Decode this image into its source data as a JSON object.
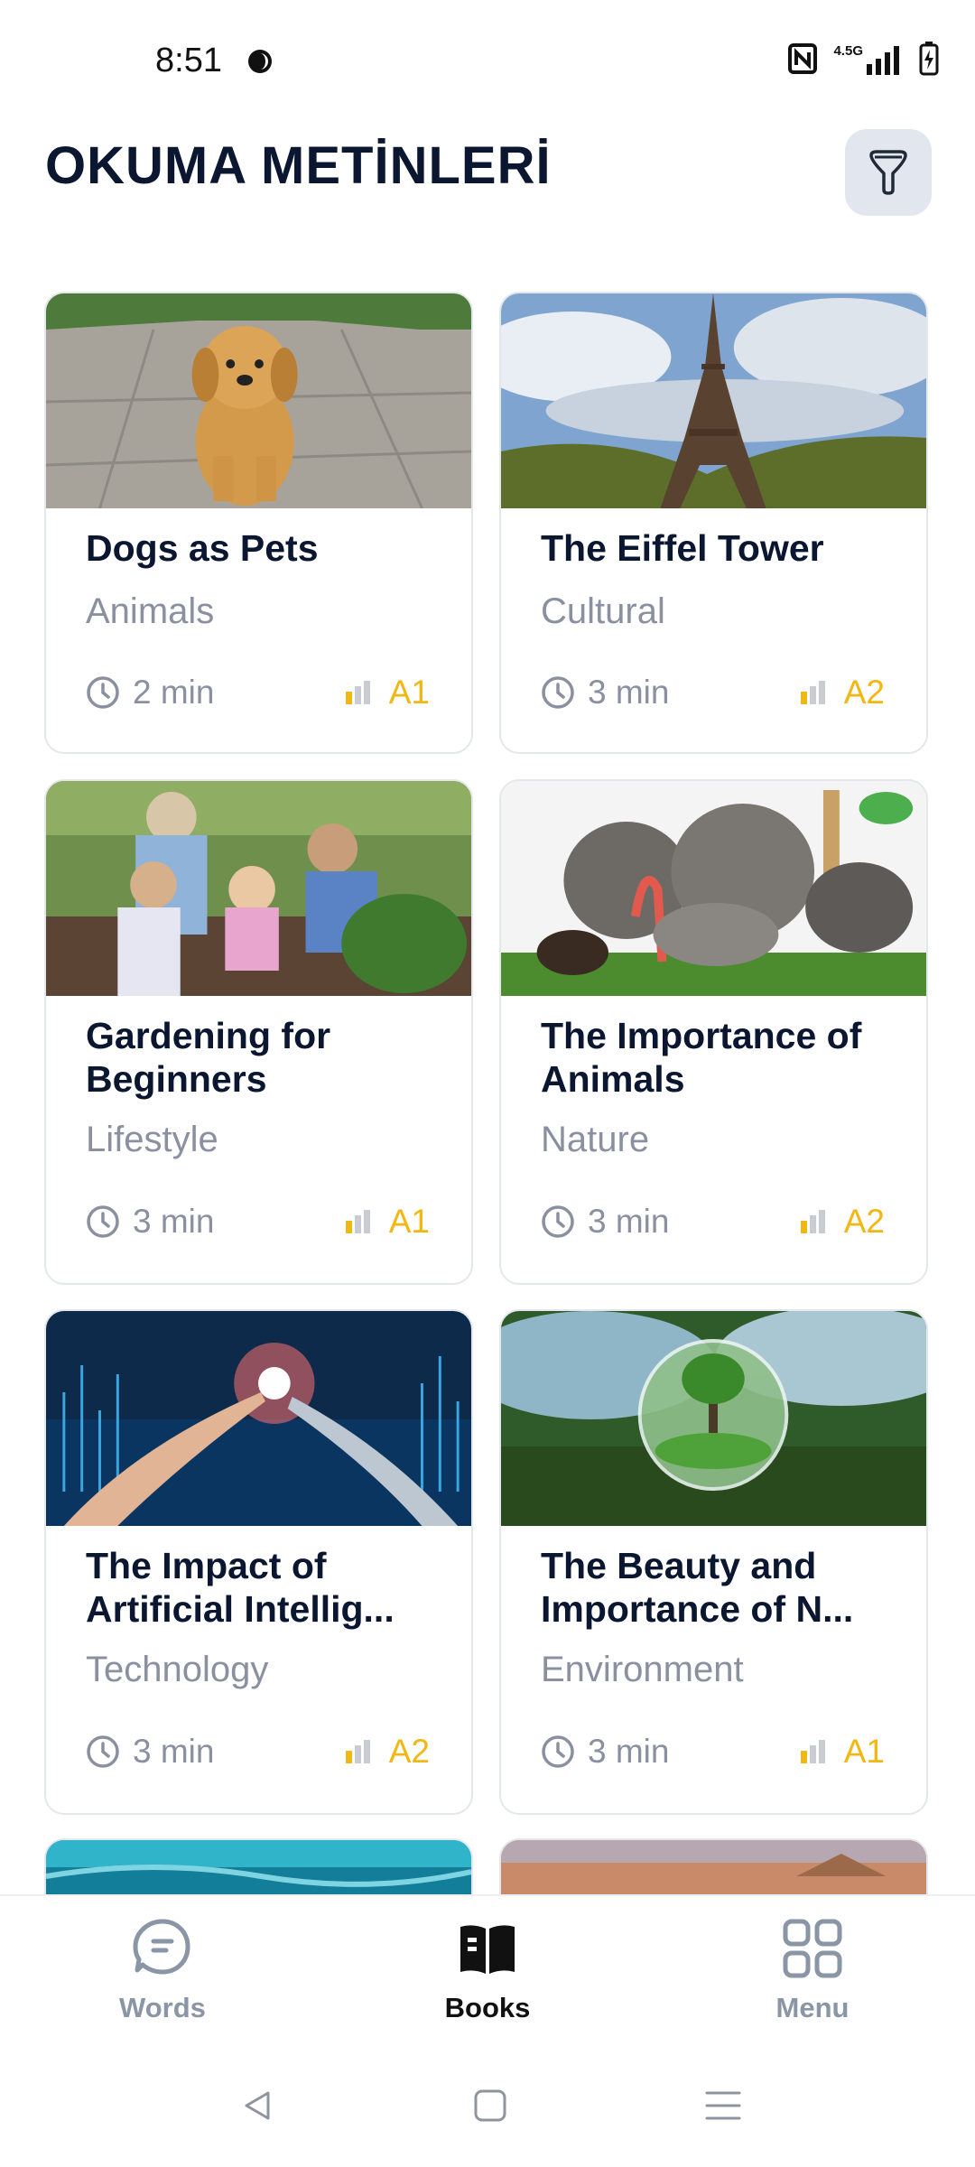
{
  "status": {
    "time": "8:51",
    "network": "4.5G"
  },
  "header": {
    "title": "OKUMA METİNLERİ"
  },
  "cards": [
    {
      "title": "Dogs as Pets",
      "category": "Animals",
      "duration": "2 min",
      "level": "A1",
      "image": "dog-photo"
    },
    {
      "title": "The Eiffel Tower",
      "category": "Cultural",
      "duration": "3 min",
      "level": "A2",
      "image": "eiffel-tower-photo"
    },
    {
      "title": "Gardening for Beginners",
      "category": "Lifestyle",
      "duration": "3 min",
      "level": "A1",
      "image": "gardening-family-photo"
    },
    {
      "title": "The Importance of Animals",
      "category": "Nature",
      "duration": "3 min",
      "level": "A2",
      "image": "animals-collage-photo"
    },
    {
      "title": "The Impact of Artificial Intellig...",
      "category": "Technology",
      "duration": "3 min",
      "level": "A2",
      "image": "ai-hands-photo"
    },
    {
      "title": "The Beauty and Importance of N...",
      "category": "Environment",
      "duration": "3 min",
      "level": "A1",
      "image": "glass-globe-nature-photo"
    }
  ],
  "nav": {
    "words": "Words",
    "books": "Books",
    "menu": "Menu"
  },
  "colors": {
    "accent": "#f2b712",
    "title": "#0b1730",
    "muted": "#8a90a0",
    "active": "#111111"
  }
}
